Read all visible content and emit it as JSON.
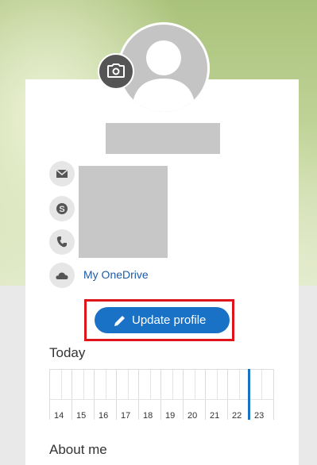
{
  "profile": {
    "change_photo_icon": "camera-icon",
    "avatar_icon": "person-silhouette"
  },
  "contacts": [
    {
      "icon": "mail-icon"
    },
    {
      "icon": "skype-icon"
    },
    {
      "icon": "phone-icon"
    }
  ],
  "onedrive": {
    "icon": "cloud-icon",
    "label": "My OneDrive"
  },
  "update_button": {
    "icon": "pencil-icon",
    "label": "Update profile"
  },
  "today": {
    "title": "Today",
    "days": [
      "14",
      "15",
      "16",
      "17",
      "18",
      "19",
      "20",
      "21",
      "22",
      "23"
    ],
    "current_day": "23"
  },
  "about": {
    "title": "About me"
  },
  "colors": {
    "accent": "#1a72c6",
    "highlight": "#e0151b",
    "link": "#1d5aa8"
  }
}
